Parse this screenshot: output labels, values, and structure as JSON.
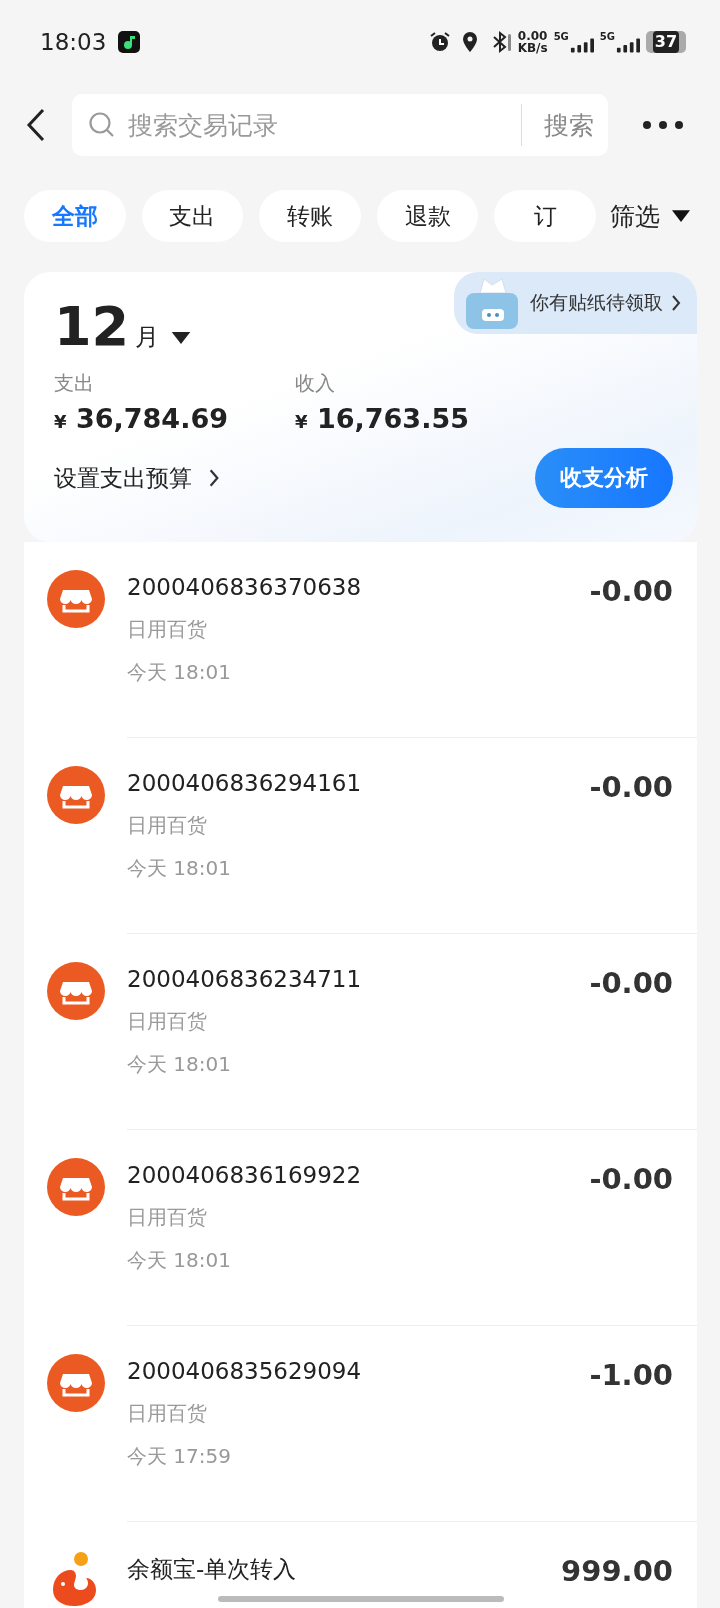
{
  "status_bar": {
    "time": "18:03",
    "net_speed": "0.00",
    "net_unit": "KB/s",
    "sim1": "5G",
    "sim2": "5G",
    "battery": "37"
  },
  "search": {
    "placeholder": "搜索交易记录",
    "button": "搜索"
  },
  "tabs": [
    {
      "label": "全部",
      "selected": true
    },
    {
      "label": "支出",
      "selected": false
    },
    {
      "label": "转账",
      "selected": false
    },
    {
      "label": "退款",
      "selected": false
    },
    {
      "label": "订",
      "selected": false
    }
  ],
  "filter": "筛选",
  "summary": {
    "month": "12",
    "month_unit": "月",
    "sticker": "你有贴纸待领取",
    "expense_label": "支出",
    "expense": "36,784.69",
    "income_label": "收入",
    "income": "16,763.55",
    "currency": "¥",
    "budget": "设置支出预算",
    "analysis_button": "收支分析"
  },
  "transactions": [
    {
      "kind": "shop",
      "title": "2000406836370638",
      "category": "日用百货",
      "time": "今天 18:01",
      "amount": "-0.00"
    },
    {
      "kind": "shop",
      "title": "2000406836294161",
      "category": "日用百货",
      "time": "今天 18:01",
      "amount": "-0.00"
    },
    {
      "kind": "shop",
      "title": "2000406836234711",
      "category": "日用百货",
      "time": "今天 18:01",
      "amount": "-0.00"
    },
    {
      "kind": "shop",
      "title": "2000406836169922",
      "category": "日用百货",
      "time": "今天 18:01",
      "amount": "-0.00"
    },
    {
      "kind": "shop",
      "title": "2000406835629094",
      "category": "日用百货",
      "time": "今天 17:59",
      "amount": "-1.00"
    },
    {
      "kind": "fund",
      "title": "余额宝-单次转入",
      "amount": "999.00"
    }
  ]
}
